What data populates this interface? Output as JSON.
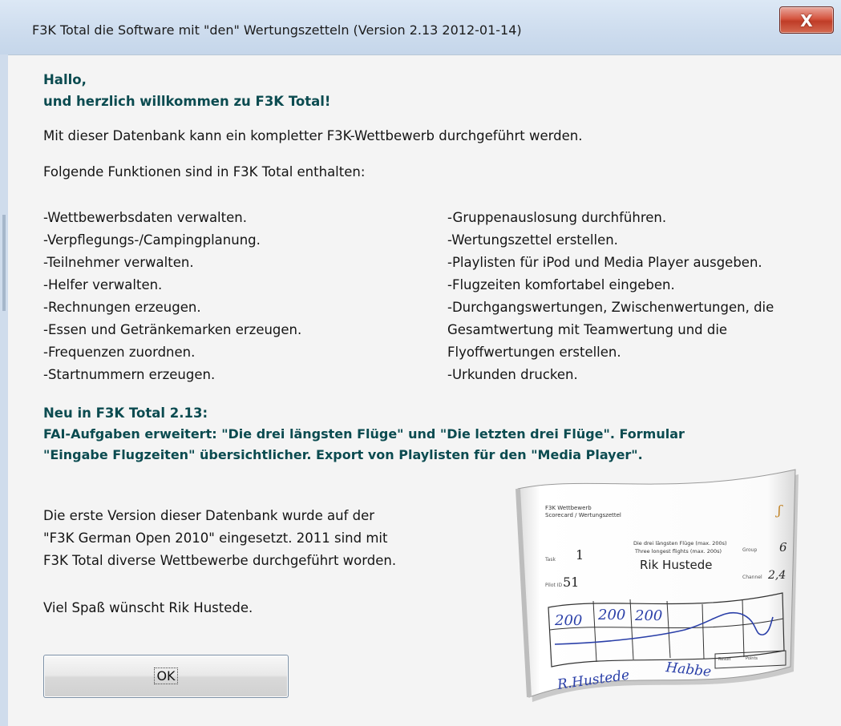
{
  "window": {
    "title": "F3K Total die Software mit \"den\" Wertungszetteln (Version 2.13 2012-01-14)",
    "close_label": "X"
  },
  "greeting": [
    "Hallo,",
    "und herzlich willkommen zu F3K Total!"
  ],
  "intro": "Mit dieser Datenbank kann ein kompletter F3K-Wettbewerb durchgeführt werden.",
  "features_heading": "Folgende Funktionen sind in F3K Total enthalten:",
  "features_left": [
    "-Wettbewerbsdaten verwalten.",
    "-Verpflegungs-/Campingplanung.",
    "-Teilnehmer verwalten.",
    "-Helfer verwalten.",
    "-Rechnungen erzeugen.",
    "-Essen und Getränkemarken erzeugen.",
    "-Frequenzen zuordnen.",
    "-Startnummern erzeugen."
  ],
  "features_right": [
    "-Gruppenauslosung durchführen.",
    "-Wertungszettel erstellen.",
    "-Playlisten für iPod und Media Player ausgeben.",
    "-Flugzeiten komfortabel eingeben.",
    "-Durchgangswertungen, Zwischenwertungen, die",
    " Gesamtwertung mit Teamwertung und die",
    " Flyoffwertungen erstellen.",
    "-Urkunden drucken."
  ],
  "new_heading": "Neu in F3K Total 2.13:",
  "new_lines": [
    "FAI-Aufgaben erweitert: \"Die drei längsten Flüge\" und \"Die letzten drei Flüge\". Formular",
    "\"Eingabe Flugzeiten\" übersichtlicher. Export von Playlisten für den \"Media Player\"."
  ],
  "history": [
    "Die erste Version dieser Datenbank wurde auf der",
    "\"F3K German Open 2010\" eingesetzt. 2011 sind mit",
    "F3K Total diverse Wettbewerbe durchgeführt worden."
  ],
  "signoff": "Viel Spaß wünscht Rik Hustede.",
  "ok_button": "OK",
  "scorecard": {
    "header_line1": "F3K Wettbewerb",
    "header_line2": "Scorecard / Wertungszettel",
    "round_label": "Task",
    "round_value": "1",
    "pilot_label": "Pilot ID",
    "pilot_value": "51",
    "task_line1": "Die drei längsten Flüge (max. 200s)",
    "task_line2": "Three longest flights (max. 200s)",
    "pilot_name": "Rik Hustede",
    "group_label": "Group",
    "group_value": "6",
    "channel_label": "Channel",
    "channel_value": "2,4",
    "times": [
      "200",
      "200",
      "200"
    ],
    "signature_pilot": "R.Hustede",
    "signature_helper": "Habbe",
    "result_label": "Result",
    "points_label": "Points"
  },
  "colors": {
    "heading_teal": "#0b4b50",
    "close_red": "#c7432c",
    "client_bg": "#f4f4f4"
  }
}
